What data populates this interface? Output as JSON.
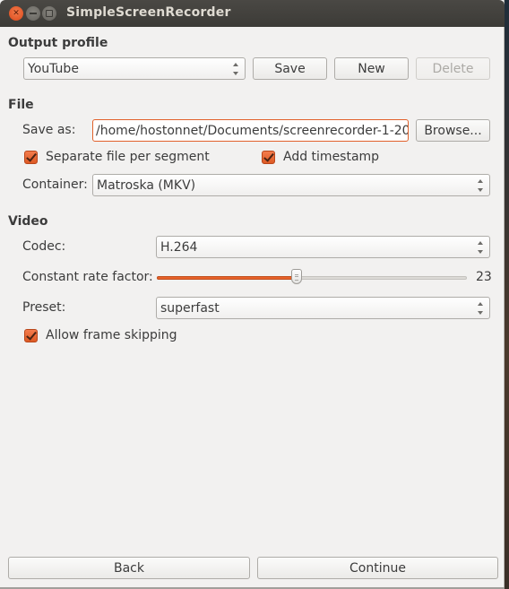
{
  "window": {
    "title": "SimpleScreenRecorder",
    "controls": [
      "close",
      "minimize",
      "maximize"
    ]
  },
  "output_profile": {
    "heading": "Output profile",
    "profile_selected": "YouTube",
    "save_label": "Save",
    "new_label": "New",
    "delete_label": "Delete",
    "delete_enabled": false
  },
  "file": {
    "heading": "File",
    "save_as_label": "Save as:",
    "save_as_value": "/home/hostonnet/Documents/screenrecorder-1-20",
    "browse_label": "Browse...",
    "separate_file_label": "Separate file per segment",
    "separate_file_checked": true,
    "add_timestamp_label": "Add timestamp",
    "add_timestamp_checked": true,
    "container_label": "Container:",
    "container_selected": "Matroska (MKV)"
  },
  "video": {
    "heading": "Video",
    "codec_label": "Codec:",
    "codec_selected": "H.264",
    "crf_label": "Constant rate factor:",
    "crf_value": "23",
    "crf_min": 0,
    "crf_max": 51,
    "preset_label": "Preset:",
    "preset_selected": "superfast",
    "allow_frame_skipping_label": "Allow frame skipping",
    "allow_frame_skipping_checked": true
  },
  "footer": {
    "back_label": "Back",
    "continue_label": "Continue"
  }
}
